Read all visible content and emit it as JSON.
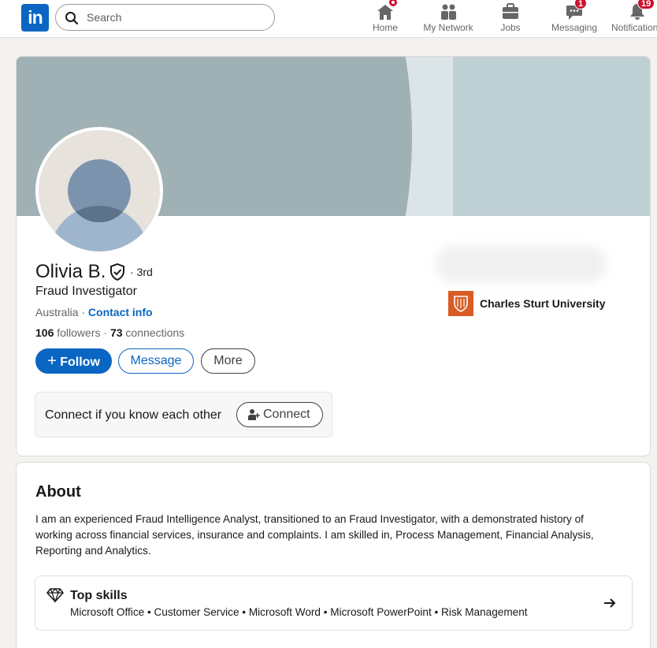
{
  "nav": {
    "logo_text": "in",
    "search_placeholder": "Search",
    "items": [
      {
        "label": "Home",
        "badge": ""
      },
      {
        "label": "My Network",
        "badge": ""
      },
      {
        "label": "Jobs",
        "badge": ""
      },
      {
        "label": "Messaging",
        "badge": "1"
      },
      {
        "label": "Notifications",
        "badge": "19"
      }
    ]
  },
  "profile": {
    "name": "Olivia B.",
    "degree": "· 3rd",
    "headline": "Fraud Investigator",
    "location": "Australia",
    "location_sep": " · ",
    "contact_info": "Contact info",
    "followers_count": "106",
    "followers_label": " followers",
    "connections_sep": " · ",
    "connections_count": "73",
    "connections_label": " connections",
    "education": "Charles Sturt University"
  },
  "actions": {
    "follow": "Follow",
    "message": "Message",
    "more": "More",
    "connect_prompt": "Connect if you know each other",
    "connect": "Connect"
  },
  "about": {
    "title": "About",
    "text": "I am an experienced Fraud Intelligence Analyst, transitioned to an Fraud Investigator, with a demonstrated history of working across financial services, insurance and complaints. I am skilled in, Process Management, Financial Analysis, Reporting and Analytics.",
    "top_skills_title": "Top skills",
    "top_skills": "Microsoft Office • Customer Service • Microsoft Word • Microsoft PowerPoint • Risk Management"
  },
  "colors": {
    "brand": "#0a66c2",
    "badge": "#cb112d",
    "university": "#d85c26"
  }
}
